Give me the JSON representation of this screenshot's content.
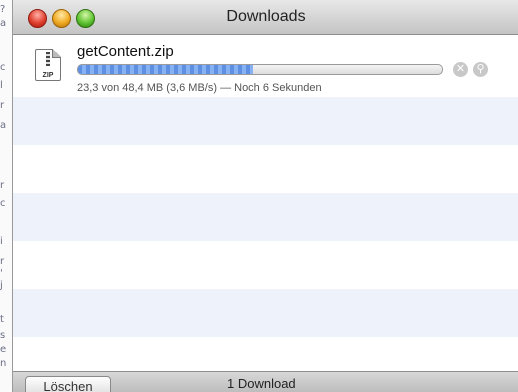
{
  "window": {
    "title": "Downloads"
  },
  "download": {
    "filename": "getContent.zip",
    "file_type_label": "ZIP",
    "progress": 0.48,
    "status": "23,3 von 48,4 MB (3,6 MB/s) — Noch 6 Sekunden"
  },
  "footer": {
    "clear_label": "Löschen",
    "count": "1 Download"
  },
  "background_fragments": [
    "?",
    "a",
    "c",
    "l",
    "r",
    "a",
    "r",
    "c",
    "i",
    "r",
    "'",
    "j",
    "t",
    "s",
    "e",
    "n"
  ]
}
